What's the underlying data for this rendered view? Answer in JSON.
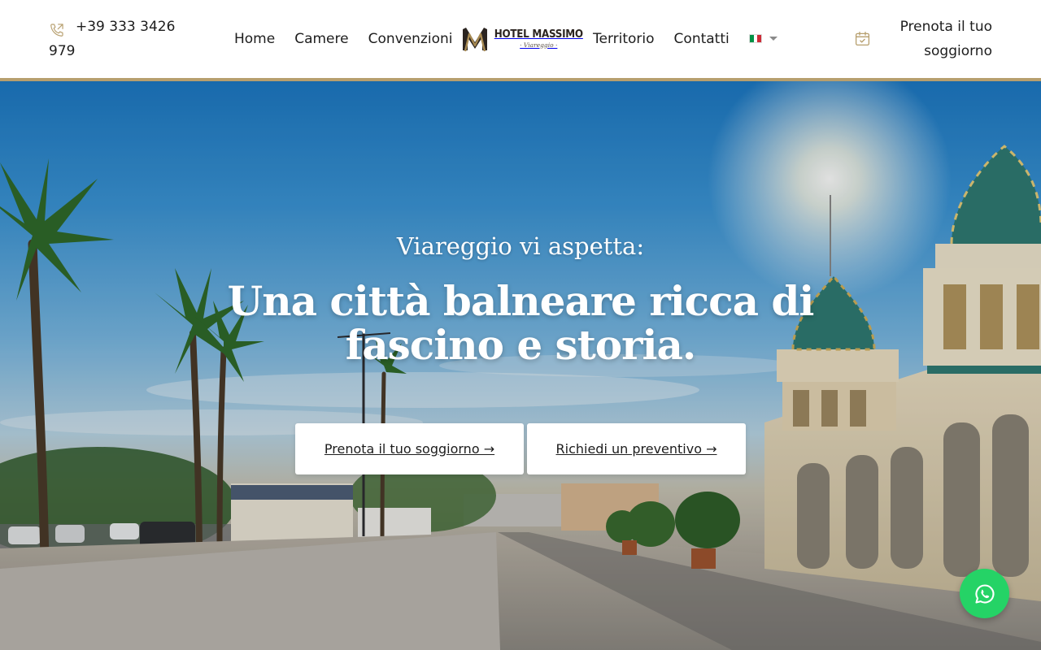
{
  "header": {
    "phone": "+39 333 3426 979",
    "nav_left": [
      "Home",
      "Camere",
      "Convenzioni"
    ],
    "nav_right": [
      "Territorio",
      "Contatti"
    ],
    "logo": {
      "name": "HOTEL MASSIMO",
      "subtitle": "· Viareggio ·"
    },
    "language": "it",
    "booking_cta": "Prenota il tuo soggiorno"
  },
  "hero": {
    "subtitle": "Viareggio vi aspetta:",
    "title": "Una città balneare ricca di fascino e storia.",
    "buttons": {
      "book": "Prenota il tuo soggiorno →",
      "quote": "Richiedi un preventivo →"
    }
  },
  "floating": {
    "whatsapp_icon": "whatsapp-icon"
  },
  "colors": {
    "accent": "#b79f6e",
    "whatsapp": "#25d366",
    "text": "#1d1d1d"
  },
  "icons": [
    "phone-icon",
    "calendar-check-icon",
    "flag-italy-icon",
    "chevron-down-icon",
    "whatsapp-icon"
  ]
}
